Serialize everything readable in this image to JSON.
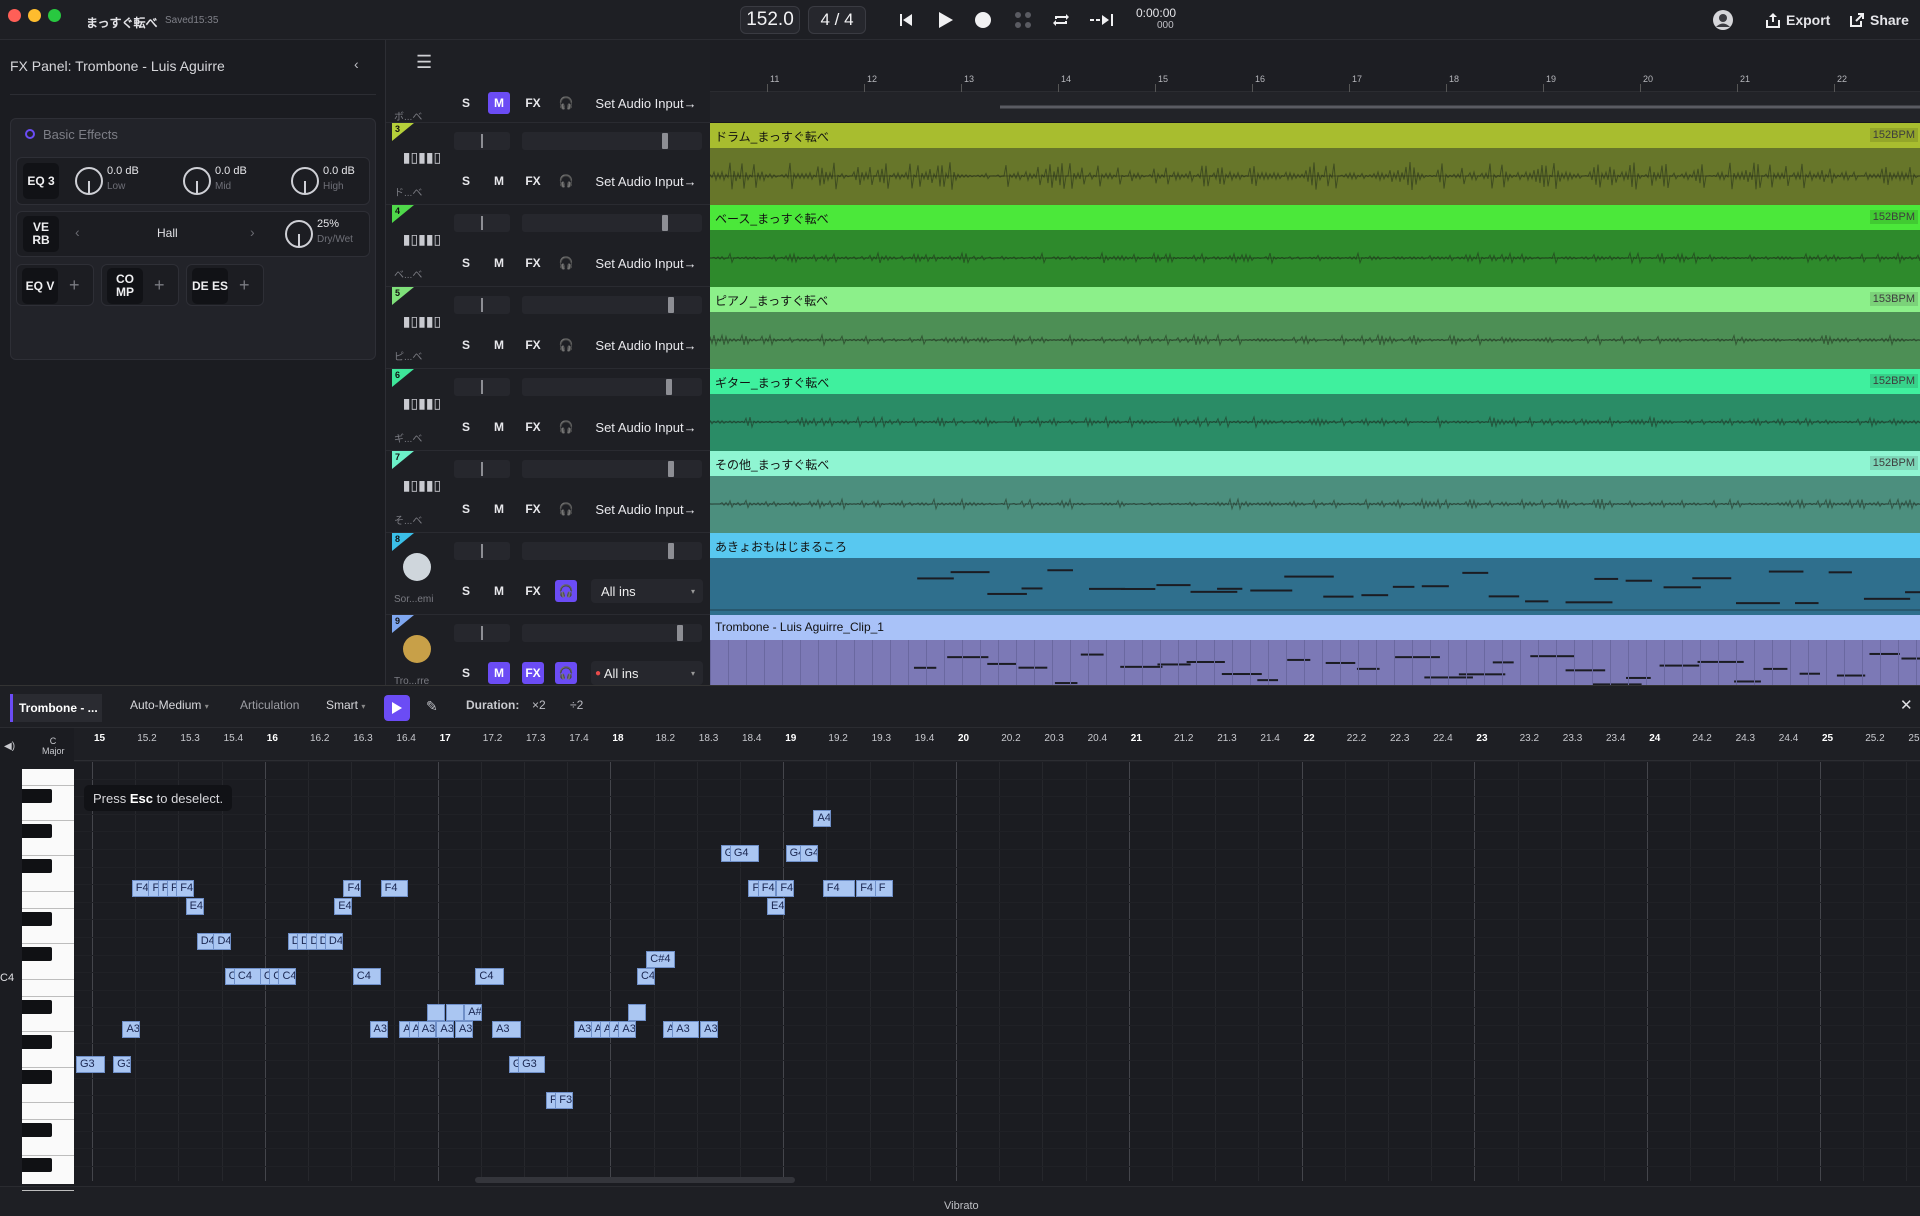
{
  "app": {
    "project_title": "まっすぐ転べ",
    "saved_status": "Saved15:35",
    "tempo": "152.0",
    "time_signature": "4 / 4",
    "time_main": "0:00:00",
    "time_sub": "000",
    "export_label": "Export",
    "share_label": "Share"
  },
  "fx_panel": {
    "title": "FX Panel: Trombone - Luis Aguirre",
    "section_title": "Basic Effects",
    "eq3": {
      "label": "EQ 3",
      "low_value": "0.0 dB",
      "low_label": "Low",
      "mid_value": "0.0 dB",
      "mid_label": "Mid",
      "high_value": "0.0 dB",
      "high_label": "High"
    },
    "reverb": {
      "label": "VE RB",
      "preset": "Hall",
      "drywet_value": "25%",
      "drywet_label": "Dry/Wet"
    },
    "slots": [
      {
        "label": "EQ V"
      },
      {
        "label": "CO MP"
      },
      {
        "label": "DE ES"
      }
    ]
  },
  "tracks": [
    {
      "number": "",
      "name": "ボ...ベ",
      "input_label": "Set Audio Input",
      "mute_on": true,
      "fx_on": false,
      "monitor_on": false
    },
    {
      "number": "3",
      "name": "ド...ベ",
      "input_label": "Set Audio Input",
      "mute_on": false,
      "fx_on": false,
      "monitor_on": false,
      "color": "#b5cf3a"
    },
    {
      "number": "4",
      "name": "ベ...ベ",
      "input_label": "Set Audio Input",
      "mute_on": false,
      "fx_on": false,
      "monitor_on": false,
      "color": "#4fd84a"
    },
    {
      "number": "5",
      "name": "ピ...ベ",
      "input_label": "Set Audio Input",
      "mute_on": false,
      "fx_on": false,
      "monitor_on": false,
      "color": "#7fe07a"
    },
    {
      "number": "6",
      "name": "ギ...ベ",
      "input_label": "Set Audio Input",
      "mute_on": false,
      "fx_on": false,
      "monitor_on": false,
      "color": "#3ee69a"
    },
    {
      "number": "7",
      "name": "そ...ベ",
      "input_label": "Set Audio Input",
      "mute_on": false,
      "fx_on": false,
      "monitor_on": false,
      "color": "#6cf0c8"
    },
    {
      "number": "8",
      "name": "Sor...emi",
      "input_label": "All ins",
      "mute_on": false,
      "fx_on": false,
      "monitor_on": true,
      "color": "#3bbfe8"
    },
    {
      "number": "9",
      "name": "Tro...rre",
      "input_label": "All ins",
      "mute_on": true,
      "fx_on": true,
      "monitor_on": true,
      "color": "#7fa7f0"
    }
  ],
  "button_labels": {
    "solo": "S",
    "mute": "M",
    "fx": "FX"
  },
  "ruler_bars": [
    "11",
    "12",
    "13",
    "14",
    "15",
    "16",
    "17",
    "18",
    "19",
    "20",
    "21",
    "22"
  ],
  "clips": [
    {
      "name": "ドラム_まっすぐ転べ",
      "bpm": "152BPM",
      "head": "#a8bd2f",
      "body": "#67762a"
    },
    {
      "name": "ベース_まっすぐ転べ",
      "bpm": "152BPM",
      "head": "#4be83a",
      "body": "#2e8a2c"
    },
    {
      "name": "ピアノ_まっすぐ転べ",
      "bpm": "153BPM",
      "head": "#8cf08a",
      "body": "#4d8f55"
    },
    {
      "name": "ギター_まっすぐ転べ",
      "bpm": "152BPM",
      "head": "#3ff09e",
      "body": "#2a8c66"
    },
    {
      "name": "その他_まっすぐ転べ",
      "bpm": "152BPM",
      "head": "#8ff5d2",
      "body": "#4c8f7e"
    },
    {
      "name": "あきょおもはじまるころ",
      "bpm": "",
      "head": "#58c8f0",
      "body": "#2f6f8d"
    },
    {
      "name": "Trombone - Luis Aguirre_Clip_1",
      "bpm": "",
      "head": "#a9c2f8",
      "body": "#7c79b6"
    }
  ],
  "piano_roll": {
    "track_tab": "Trombone - ...",
    "quantize": "Auto-Medium",
    "articulation": "Articulation",
    "mode": "Smart",
    "duration_label": "Duration:",
    "dur_x2": "×2",
    "dur_div2": "÷2",
    "key_name": "C",
    "key_scale": "Major",
    "hint_prefix": "Press",
    "hint_key": "Esc",
    "hint_suffix": "to deselect.",
    "c4_label": "C4",
    "bottom_label": "Vibrato",
    "ruler": [
      "15",
      "15.2",
      "15.3",
      "15.4",
      "16",
      "16.2",
      "16.3",
      "16.4",
      "17",
      "17.2",
      "17.3",
      "17.4",
      "18",
      "18.2",
      "18.3",
      "18.4",
      "19",
      "19.2",
      "19.3",
      "19.4",
      "20",
      "20.2",
      "20.3",
      "20.4",
      "21",
      "21.2",
      "21.3",
      "21.4",
      "22",
      "22.2",
      "22.3",
      "22.4",
      "23",
      "23.2",
      "23.3",
      "23.4",
      "24",
      "24.2",
      "24.3",
      "24.4",
      "25",
      "25.2",
      "25"
    ]
  },
  "notes": [
    {
      "label": "G3",
      "pitch": "G3",
      "beat": 0.0,
      "len": 0.45
    },
    {
      "label": "G3",
      "pitch": "G3",
      "beat": 1.0,
      "len": 0.25
    },
    {
      "label": "A3",
      "pitch": "A3",
      "beat": 1.25,
      "len": 0.25
    },
    {
      "label": "F4",
      "pitch": "F4",
      "beat": 1.5,
      "len": 0.45
    },
    {
      "label": "F4",
      "pitch": "F4",
      "beat": 1.95,
      "len": 0.25
    },
    {
      "label": "F4",
      "pitch": "F4",
      "beat": 2.2,
      "len": 0.25
    },
    {
      "label": "F4",
      "pitch": "F4",
      "beat": 2.45,
      "len": 0.25
    },
    {
      "label": "F4",
      "pitch": "F4",
      "beat": 2.7,
      "len": 0.25
    },
    {
      "label": "E4",
      "pitch": "E4",
      "beat": 2.95,
      "len": 0.25
    },
    {
      "label": "D4",
      "pitch": "D4",
      "beat": 3.25,
      "len": 0.45
    },
    {
      "label": "D4",
      "pitch": "D4",
      "beat": 3.7,
      "len": 0.3
    },
    {
      "label": "C4",
      "pitch": "C4",
      "beat": 4.0,
      "len": 0.25
    },
    {
      "label": "C4",
      "pitch": "C4",
      "beat": 4.25,
      "len": 0.4
    },
    {
      "label": "C4",
      "pitch": "C4",
      "beat": 4.95,
      "len": 0.25
    },
    {
      "label": "C4",
      "pitch": "C4",
      "beat": 5.2,
      "len": 0.25
    },
    {
      "label": "C4",
      "pitch": "C4",
      "beat": 5.45,
      "len": 0.25
    },
    {
      "label": "D4",
      "pitch": "D4",
      "beat": 5.7,
      "len": 0.25
    },
    {
      "label": "D4",
      "pitch": "D4",
      "beat": 5.95,
      "len": 0.25
    },
    {
      "label": "D4",
      "pitch": "D4",
      "beat": 6.2,
      "len": 0.25
    },
    {
      "label": "D4",
      "pitch": "D4",
      "beat": 6.45,
      "len": 0.25
    },
    {
      "label": "D4",
      "pitch": "D4",
      "beat": 6.7,
      "len": 0.25
    },
    {
      "label": "E4",
      "pitch": "E4",
      "beat": 6.95,
      "len": 0.25
    },
    {
      "label": "F4",
      "pitch": "F4",
      "beat": 7.2,
      "len": 0.25
    },
    {
      "label": "C4",
      "pitch": "C4",
      "beat": 7.45,
      "len": 0.45
    },
    {
      "label": "A3",
      "pitch": "A3",
      "beat": 7.9,
      "len": 0.25
    },
    {
      "label": "F4",
      "pitch": "F4",
      "beat": 8.2,
      "len": 0.4
    },
    {
      "label": "A3",
      "pitch": "A3",
      "beat": 8.7,
      "len": 0.25
    },
    {
      "label": "A3",
      "pitch": "A3",
      "beat": 8.95,
      "len": 0.25
    },
    {
      "label": "A3",
      "pitch": "A3",
      "beat": 9.2,
      "len": 0.25
    },
    {
      "label": "",
      "pitch": "A#3",
      "beat": 9.45,
      "len": 0.25
    },
    {
      "label": "A3",
      "pitch": "A3",
      "beat": 9.7,
      "len": 0.25
    },
    {
      "label": "",
      "pitch": "A#3",
      "beat": 9.95,
      "len": 0.25
    },
    {
      "label": "A3",
      "pitch": "A3",
      "beat": 10.2,
      "len": 0.25
    },
    {
      "label": "A#3",
      "pitch": "A#3",
      "beat": 10.45,
      "len": 0.3
    },
    {
      "label": "C4",
      "pitch": "C4",
      "beat": 10.75,
      "len": 0.45
    },
    {
      "label": "A3",
      "pitch": "A3",
      "beat": 11.2,
      "len": 0.45
    },
    {
      "label": "G3",
      "pitch": "G3",
      "beat": 11.65,
      "len": 0.25
    },
    {
      "label": "G3",
      "pitch": "G3",
      "beat": 11.9,
      "len": 0.4
    },
    {
      "label": "F3",
      "pitch": "F3",
      "beat": 12.65,
      "len": 0.25
    },
    {
      "label": "F3",
      "pitch": "F3",
      "beat": 12.9,
      "len": 0.25
    },
    {
      "label": "A3",
      "pitch": "A3",
      "beat": 13.4,
      "len": 0.45
    },
    {
      "label": "A3",
      "pitch": "A3",
      "beat": 13.85,
      "len": 0.25
    },
    {
      "label": "A3",
      "pitch": "A3",
      "beat": 14.1,
      "len": 0.25
    },
    {
      "label": "A3",
      "pitch": "A3",
      "beat": 14.35,
      "len": 0.25
    },
    {
      "label": "A3",
      "pitch": "A3",
      "beat": 14.6,
      "len": 0.25
    },
    {
      "label": "",
      "pitch": "A#3",
      "beat": 14.85,
      "len": 0.25
    },
    {
      "label": "C4",
      "pitch": "C4",
      "beat": 15.1,
      "len": 0.25
    },
    {
      "label": "C#4",
      "pitch": "C#4",
      "beat": 15.35,
      "len": 0.45
    },
    {
      "label": "A3",
      "pitch": "A3",
      "beat": 15.8,
      "len": 0.25
    },
    {
      "label": "A3",
      "pitch": "A3",
      "beat": 16.05,
      "len": 0.4
    },
    {
      "label": "A3",
      "pitch": "A3",
      "beat": 16.8,
      "len": 0.25
    },
    {
      "label": "G4",
      "pitch": "G4",
      "beat": 17.35,
      "len": 0.25
    },
    {
      "label": "G4",
      "pitch": "G4",
      "beat": 17.6,
      "len": 0.45
    },
    {
      "label": "F4",
      "pitch": "F4",
      "beat": 18.1,
      "len": 0.25
    },
    {
      "label": "F4",
      "pitch": "F4",
      "beat": 18.35,
      "len": 0.25
    },
    {
      "label": "E4",
      "pitch": "E4",
      "beat": 18.6,
      "len": 0.25
    },
    {
      "label": "F4",
      "pitch": "F4",
      "beat": 18.85,
      "len": 0.25
    },
    {
      "label": "G4",
      "pitch": "G4",
      "beat": 19.1,
      "len": 0.4
    },
    {
      "label": "G4",
      "pitch": "G4",
      "beat": 19.5,
      "len": 0.25
    },
    {
      "label": "A4",
      "pitch": "A4",
      "beat": 19.85,
      "len": 0.25
    },
    {
      "label": "F4",
      "pitch": "F4",
      "beat": 20.1,
      "len": 0.55
    },
    {
      "label": "F4",
      "pitch": "F4",
      "beat": 21.0,
      "len": 0.45
    },
    {
      "label": "F",
      "pitch": "F4",
      "beat": 21.5,
      "len": 0.25
    }
  ]
}
